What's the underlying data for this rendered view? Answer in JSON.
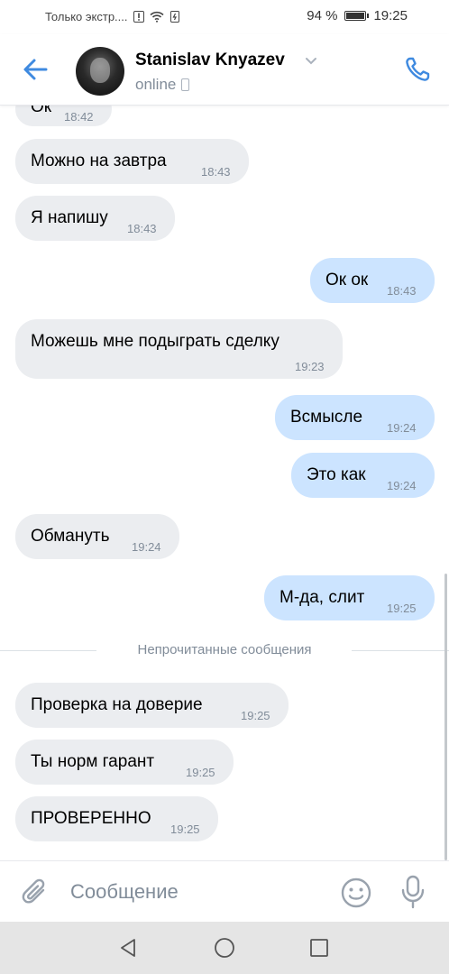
{
  "status_bar": {
    "carrier": "Только экстр....",
    "battery_percent": "94 %",
    "battery_level": 0.94,
    "time": "19:25"
  },
  "header": {
    "contact_name": "Stanislav Knyazev",
    "presence": "online",
    "icons": {
      "back": "arrow-left-icon",
      "call": "phone-icon",
      "dropdown": "chevron-down-icon",
      "device": "mobile-device-icon"
    }
  },
  "messages": [
    {
      "direction": "in",
      "text": "Ок",
      "time": "18:42"
    },
    {
      "direction": "in",
      "text": "Можно на завтра",
      "time": "18:43"
    },
    {
      "direction": "in",
      "text": "Я напишу",
      "time": "18:43"
    },
    {
      "direction": "out",
      "text": "Ок ок",
      "time": "18:43"
    },
    {
      "direction": "in",
      "text": "Можешь мне подыграть сделку",
      "time": "19:23"
    },
    {
      "direction": "out",
      "text": "Всмысле",
      "time": "19:24"
    },
    {
      "direction": "out",
      "text": "Это как",
      "time": "19:24"
    },
    {
      "direction": "in",
      "text": "Обмануть",
      "time": "19:24"
    },
    {
      "direction": "out",
      "text": "М-да, слит",
      "time": "19:25"
    },
    {
      "direction": "in",
      "text": "Проверка на доверие",
      "time": "19:25"
    },
    {
      "direction": "in",
      "text": "Ты норм гарант",
      "time": "19:25"
    },
    {
      "direction": "in",
      "text": "ПРОВЕРЕННО",
      "time": "19:25"
    }
  ],
  "unread_divider": "Непрочитанные сообщения",
  "composer": {
    "placeholder": "Сообщение",
    "icons": {
      "attach": "paperclip-icon",
      "emoji": "smile-icon",
      "mic": "microphone-icon"
    }
  },
  "colors": {
    "accent": "#3f8ae0",
    "incoming_bubble": "#ebedf0",
    "outgoing_bubble": "#cce4ff",
    "secondary_text": "#818c99"
  }
}
